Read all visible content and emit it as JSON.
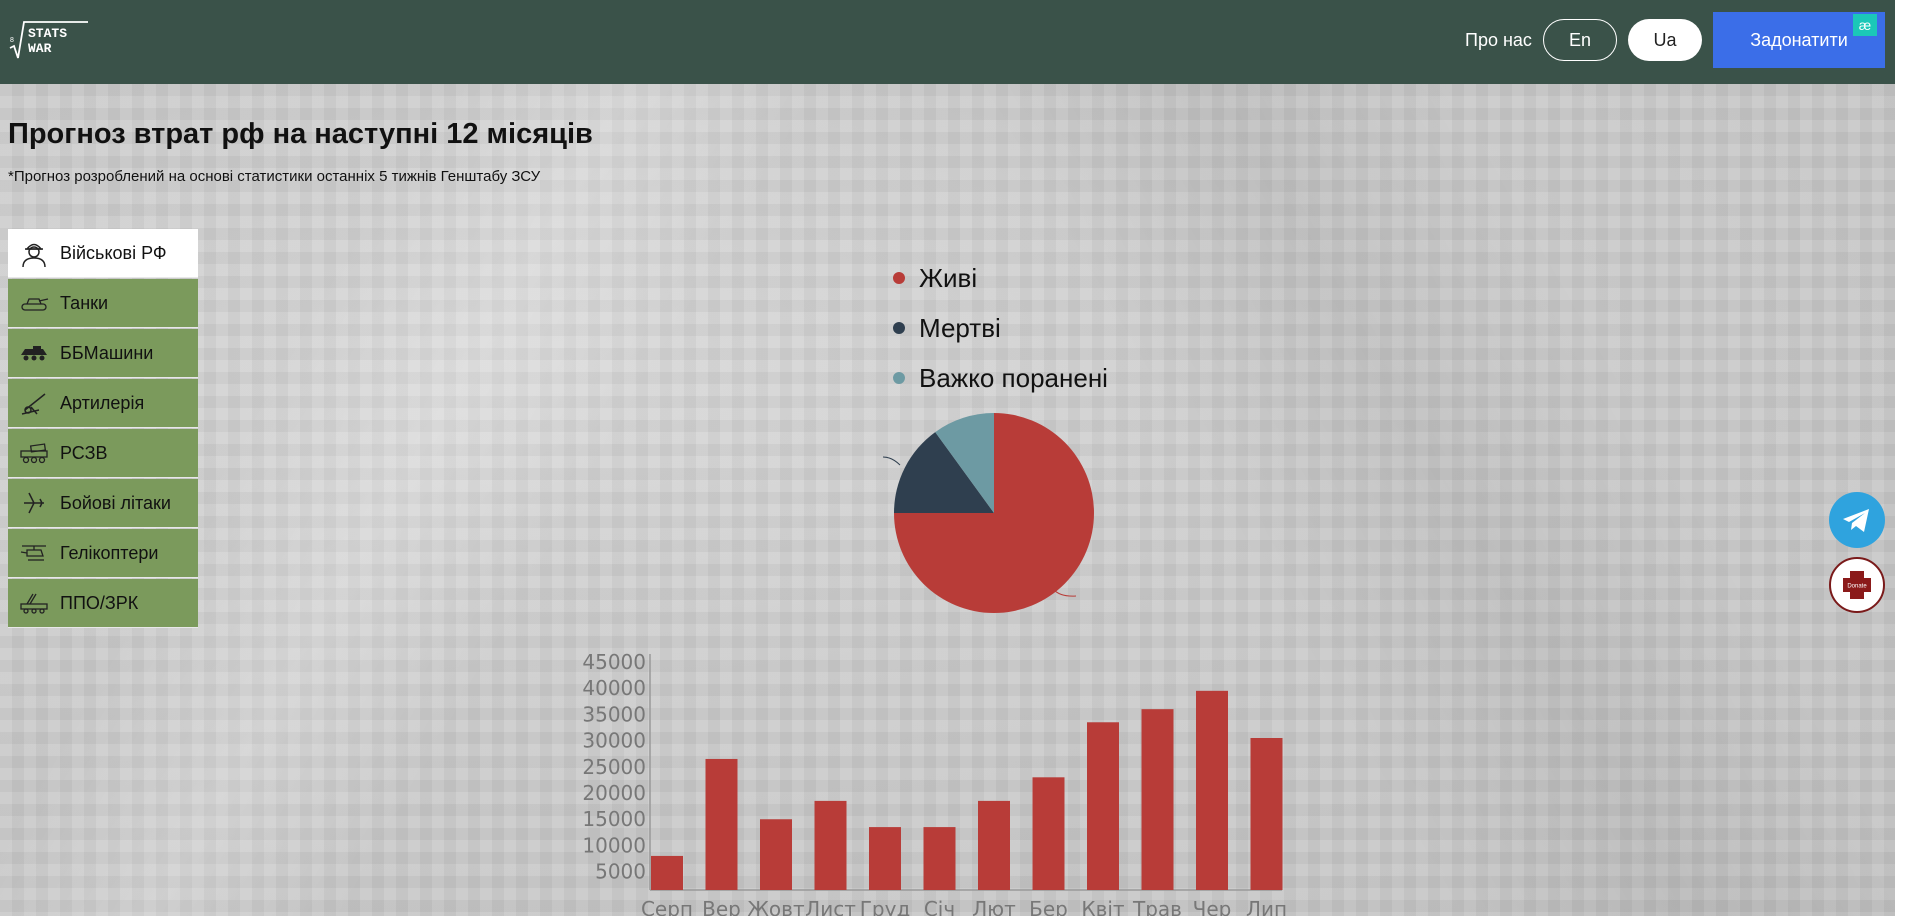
{
  "header": {
    "logo_text_line1": "STATS",
    "logo_text_line2": "WAR",
    "about_label": "Про нас",
    "lang_en_label": "En",
    "lang_ua_label": "Ua",
    "donate_label": "Задонатити",
    "badge_text": "æ"
  },
  "main": {
    "title": "Прогноз втрат рф на наступні 12 місяців",
    "subtitle": "*Прогноз розроблений на основі статистики останніх 5 тижнів Генштабу ЗСУ"
  },
  "sidebar": {
    "items": [
      {
        "label": "Військові РФ",
        "icon": "soldier-icon",
        "active": true
      },
      {
        "label": "Танки",
        "icon": "tank-icon",
        "active": false
      },
      {
        "label": "ББМашини",
        "icon": "apc-icon",
        "active": false
      },
      {
        "label": "Артилерія",
        "icon": "artillery-icon",
        "active": false
      },
      {
        "label": "РСЗВ",
        "icon": "mlrs-icon",
        "active": false
      },
      {
        "label": "Бойові літаки",
        "icon": "plane-icon",
        "active": false
      },
      {
        "label": "Гелікоптери",
        "icon": "helicopter-icon",
        "active": false
      },
      {
        "label": "ППО/ЗРК",
        "icon": "air-defense-icon",
        "active": false
      }
    ]
  },
  "floating": {
    "donate_badge_text": "Donate"
  },
  "colors": {
    "header_bg": "#3a5249",
    "donate_bg": "#3b6ee8",
    "menu_bg": "#7b9a5c",
    "alive": "#b83c38",
    "dead": "#2f3f4f",
    "wounded": "#6d9aa3"
  },
  "chart_data": [
    {
      "type": "pie",
      "legend": [
        "Живі",
        "Мертві",
        "Важко поранені"
      ],
      "values": [
        75,
        15,
        10
      ],
      "colors": [
        "#b83c38",
        "#2f3f4f",
        "#6d9aa3"
      ],
      "legend_position": "top"
    },
    {
      "type": "bar",
      "categories": [
        "Серп",
        "Вер",
        "Жовт",
        "Лист",
        "Груд",
        "Січ",
        "Лют",
        "Бер",
        "Квіт",
        "Трав",
        "Чер",
        "Лип"
      ],
      "values": [
        8000,
        26500,
        15000,
        18500,
        13500,
        13500,
        18500,
        23000,
        33500,
        36000,
        39500,
        30500
      ],
      "yticks": [
        5000,
        10000,
        15000,
        20000,
        25000,
        30000,
        35000,
        40000,
        45000
      ],
      "ylim": [
        1500,
        45000
      ],
      "color": "#b83c38",
      "grid": false
    }
  ]
}
